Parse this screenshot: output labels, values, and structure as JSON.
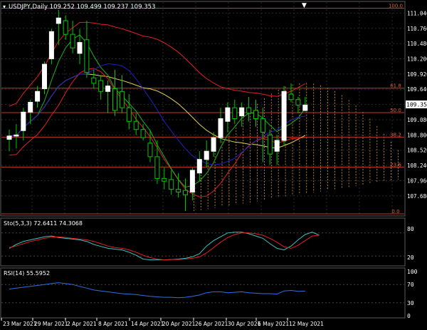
{
  "header": {
    "symbol_info": "USDJPY,Daily  109.252 109.499 109.237 109.353",
    "collapse_icon": "triangle-down-icon"
  },
  "main_panel": {
    "price_axis_ticks": [
      "111.040",
      "110.760",
      "110.480",
      "110.200",
      "109.920",
      "109.640",
      "109.353",
      "109.080",
      "108.800",
      "108.520",
      "108.240",
      "107.960",
      "107.680"
    ],
    "current_price": "109.353",
    "fib_levels": [
      {
        "label": "100.0",
        "price": 111.13
      },
      {
        "label": "61.8",
        "price": 109.66
      },
      {
        "label": "50.0",
        "price": 109.21
      },
      {
        "label": "38.2",
        "price": 108.76
      },
      {
        "label": "23.6",
        "price": 108.21
      },
      {
        "label": "0.0",
        "price": 107.35
      }
    ],
    "price_range": [
      107.35,
      111.15
    ]
  },
  "stoch_panel": {
    "label": "Sto(5,3,3) 72.6411 74.3068",
    "axis_ticks": [
      "80",
      "20"
    ]
  },
  "rsi_panel": {
    "label": "RSI(14) 55.5952",
    "axis_ticks": [
      "100",
      "70",
      "30",
      "0"
    ]
  },
  "time_axis": {
    "labels": [
      "23 Mar 2021",
      "29 Mar 2021",
      "2 Apr 2021",
      "8 Apr 2021",
      "14 Apr 2021",
      "20 Apr 2021",
      "26 Apr 2021",
      "30 Apr 2021",
      "6 May 2021",
      "12 May 2021"
    ]
  },
  "colors": {
    "background": "#000000",
    "grid": "#2a2a2a",
    "bull_candle": "#ffffff",
    "candle_wick": "#00c800",
    "fib_line": "#c0392b",
    "bollinger": "#e02020",
    "ma_yellow": "#e0d050",
    "ma_blue": "#2020c0",
    "ichimoku_green": "#20b020",
    "cloud": "#e0a040",
    "stoch_main": "#40c0c0",
    "stoch_signal": "#e02020",
    "rsi_line": "#3070e0",
    "axis_text": "#ffffff"
  },
  "chart_data": {
    "type": "candlestick",
    "title": "USDJPY,Daily",
    "ohlc": [
      [
        108.72,
        108.9,
        108.5,
        108.78
      ],
      [
        108.78,
        109.0,
        108.55,
        108.8
      ],
      [
        108.88,
        109.3,
        108.7,
        109.22
      ],
      [
        109.22,
        109.45,
        109.0,
        109.4
      ],
      [
        109.42,
        109.7,
        109.3,
        109.6
      ],
      [
        109.65,
        110.15,
        109.55,
        110.1
      ],
      [
        110.2,
        110.75,
        110.1,
        110.7
      ],
      [
        110.85,
        111.1,
        110.45,
        110.95
      ],
      [
        110.9,
        111.0,
        110.55,
        110.65
      ],
      [
        110.65,
        110.9,
        110.3,
        110.4
      ],
      [
        110.3,
        110.75,
        110.1,
        110.5
      ],
      [
        110.55,
        110.9,
        109.85,
        109.95
      ],
      [
        109.85,
        110.0,
        109.65,
        109.75
      ],
      [
        109.8,
        109.9,
        109.45,
        109.6
      ],
      [
        109.6,
        109.8,
        109.2,
        109.7
      ],
      [
        109.65,
        110.0,
        109.15,
        109.25
      ],
      [
        109.6,
        109.9,
        109.2,
        109.3
      ],
      [
        109.3,
        109.55,
        108.9,
        109.05
      ],
      [
        109.05,
        109.2,
        108.8,
        108.9
      ],
      [
        108.9,
        109.0,
        108.7,
        108.75
      ],
      [
        108.65,
        108.9,
        108.3,
        108.4
      ],
      [
        108.4,
        108.7,
        107.9,
        108.0
      ],
      [
        108.0,
        108.2,
        107.8,
        107.95
      ],
      [
        107.98,
        108.15,
        107.7,
        107.8
      ],
      [
        107.8,
        108.1,
        107.65,
        107.75
      ],
      [
        107.78,
        108.0,
        107.4,
        107.7
      ],
      [
        107.75,
        108.2,
        107.6,
        108.15
      ],
      [
        108.1,
        108.5,
        107.95,
        108.35
      ],
      [
        108.35,
        108.7,
        108.2,
        108.5
      ],
      [
        108.5,
        108.85,
        108.4,
        108.75
      ],
      [
        108.75,
        109.3,
        108.65,
        109.1
      ],
      [
        109.05,
        109.4,
        108.85,
        109.3
      ],
      [
        109.3,
        109.45,
        109.0,
        109.1
      ],
      [
        109.15,
        109.4,
        108.95,
        109.3
      ],
      [
        109.3,
        109.5,
        109.05,
        109.2
      ],
      [
        109.25,
        109.45,
        108.95,
        109.1
      ],
      [
        109.1,
        109.3,
        108.3,
        108.85
      ],
      [
        108.8,
        108.9,
        108.25,
        108.45
      ],
      [
        108.5,
        108.8,
        108.25,
        108.7
      ],
      [
        108.7,
        109.7,
        108.6,
        109.6
      ],
      [
        109.55,
        109.75,
        109.4,
        109.45
      ],
      [
        109.45,
        109.5,
        109.2,
        109.35
      ],
      [
        109.25,
        109.5,
        109.23,
        109.35
      ]
    ],
    "stoch_main": [
      40,
      50,
      58,
      62,
      66,
      70,
      72,
      68,
      66,
      64,
      62,
      58,
      50,
      45,
      40,
      38,
      36,
      30,
      22,
      12,
      10,
      10,
      10,
      11,
      12,
      14,
      18,
      26,
      46,
      60,
      70,
      80,
      82,
      82,
      78,
      72,
      66,
      52,
      40,
      36,
      46,
      62,
      76,
      82,
      74
    ],
    "stoch_signal": [
      42,
      46,
      52,
      58,
      62,
      66,
      69,
      70,
      68,
      66,
      64,
      62,
      58,
      52,
      46,
      42,
      40,
      36,
      30,
      22,
      16,
      12,
      10,
      11,
      11,
      12,
      14,
      18,
      28,
      42,
      56,
      68,
      76,
      80,
      80,
      78,
      74,
      66,
      56,
      44,
      40,
      48,
      60,
      72,
      74
    ],
    "rsi": [
      60,
      62,
      64,
      66,
      68,
      70,
      72,
      74,
      72,
      70,
      66,
      62,
      58,
      56,
      54,
      52,
      50,
      49,
      48,
      46,
      44,
      43,
      42,
      42,
      41,
      42,
      44,
      47,
      52,
      54,
      54,
      52,
      53,
      54,
      52,
      51,
      50,
      50,
      49,
      56,
      57,
      55,
      55.6
    ]
  }
}
